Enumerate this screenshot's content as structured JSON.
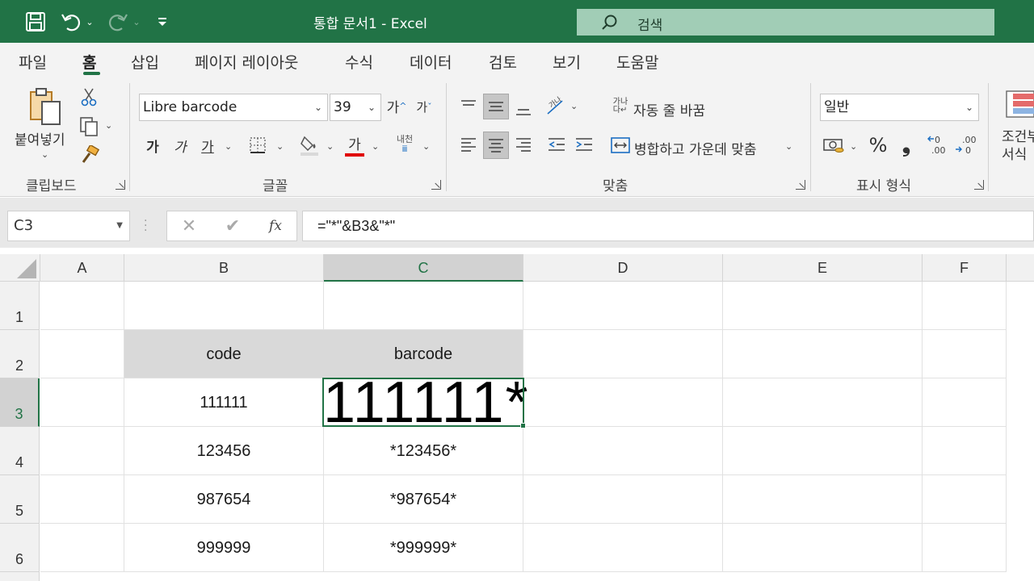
{
  "title": "통합 문서1  -  Excel",
  "search": {
    "placeholder": "검색"
  },
  "tabs": [
    "파일",
    "홈",
    "삽입",
    "페이지 레이아웃",
    "수식",
    "데이터",
    "검토",
    "보기",
    "도움말"
  ],
  "active_tab": "홈",
  "clipboard": {
    "paste_label": "붙여넣기",
    "group": "클립보드"
  },
  "font": {
    "name": "Libre barcode",
    "size": "39",
    "grow": "가",
    "shrink": "가",
    "bold": "가",
    "italic": "가",
    "underline": "가",
    "fontcolor": "가",
    "phonetic": "내천",
    "group": "글꼴"
  },
  "align": {
    "wrap": "자동 줄 바꿈",
    "merge": "병합하고 가운데 맞춤",
    "group": "맞춤"
  },
  "number": {
    "format": "일반",
    "percent": "%",
    "comma": "❟",
    "group": "표시 형식"
  },
  "styles": {
    "label_line1": "조건부",
    "label_line2": "서식"
  },
  "formula_bar": {
    "name_box": "C3",
    "fx": "fx",
    "formula": "=\"*\"&B3&\"*\""
  },
  "columns": [
    "A",
    "B",
    "C",
    "D",
    "E",
    "F"
  ],
  "rows": [
    "1",
    "2",
    "3",
    "4",
    "5",
    "6"
  ],
  "cells": {
    "B2": "code",
    "C2": "barcode",
    "B3": "111111",
    "C3": "111111*",
    "B4": "123456",
    "C4": "*123456*",
    "B5": "987654",
    "C5": "*987654*",
    "B6": "999999",
    "C6": "*999999*"
  },
  "colors": {
    "accent": "#217346",
    "search_bg": "#a1cdb6",
    "header_fill": "#d9d9d9"
  }
}
